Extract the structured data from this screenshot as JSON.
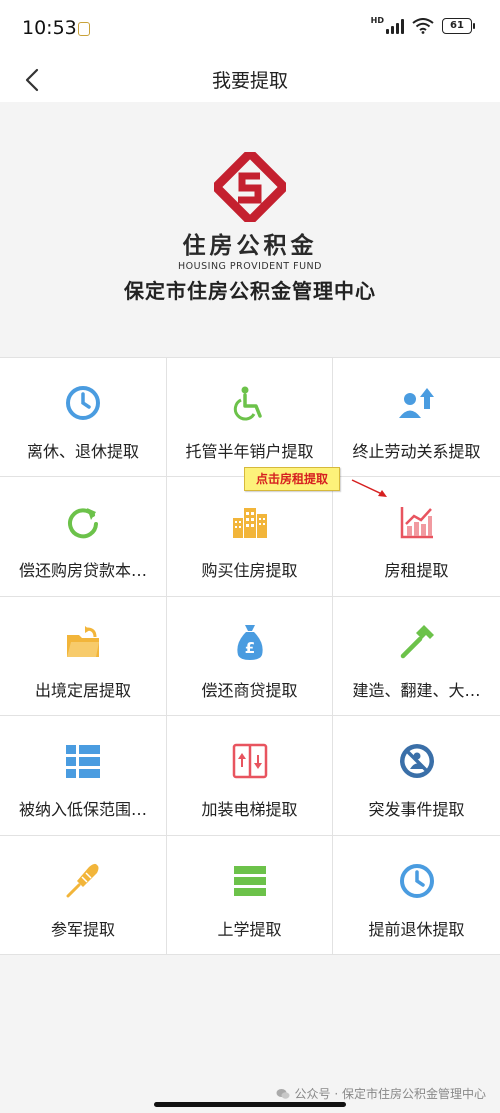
{
  "status_bar": {
    "time": "10:53",
    "network_label": "HD",
    "battery": "61"
  },
  "nav": {
    "title": "我要提取"
  },
  "brand": {
    "logo_cn": "住房公积金",
    "logo_en": "HOUSING PROVIDENT FUND",
    "org_name": "保定市住房公积金管理中心",
    "logo_color": "#c4202f"
  },
  "callout": {
    "text": "点击房租提取",
    "color": "#d62020",
    "background": "#fdf27a"
  },
  "items": [
    {
      "label": "离休、退休提取",
      "icon": "clock-icon",
      "color": "#4a9ce0"
    },
    {
      "label": "托管半年销户提取",
      "icon": "wheelchair-icon",
      "color": "#6cc24a"
    },
    {
      "label": "终止劳动关系提取",
      "icon": "user-upload-icon",
      "color": "#4a9ce0"
    },
    {
      "label": "偿还购房贷款本…",
      "icon": "refresh-icon",
      "color": "#6cc24a"
    },
    {
      "label": "购买住房提取",
      "icon": "buildings-icon",
      "color": "#f2b53a"
    },
    {
      "label": "房租提取",
      "icon": "chart-icon",
      "color": "#e8545f"
    },
    {
      "label": "出境定居提取",
      "icon": "folder-icon",
      "color": "#f2b53a"
    },
    {
      "label": "偿还商贷提取",
      "icon": "money-bag-icon",
      "color": "#4a9ce0"
    },
    {
      "label": "建造、翻建、大…",
      "icon": "hammer-icon",
      "color": "#6cc24a"
    },
    {
      "label": "被纳入低保范围…",
      "icon": "list-icon",
      "color": "#4a9ce0"
    },
    {
      "label": "加装电梯提取",
      "icon": "elevator-icon",
      "color": "#e8545f"
    },
    {
      "label": "突发事件提取",
      "icon": "prohibited-person-icon",
      "color": "#3a6fa8"
    },
    {
      "label": "参军提取",
      "icon": "screwdriver-icon",
      "color": "#f2b53a"
    },
    {
      "label": "上学提取",
      "icon": "menu-icon",
      "color": "#6cc24a"
    },
    {
      "label": "提前退休提取",
      "icon": "clock-icon",
      "color": "#4a9ce0"
    }
  ],
  "watermark": "公众号 · 保定市住房公积金管理中心"
}
